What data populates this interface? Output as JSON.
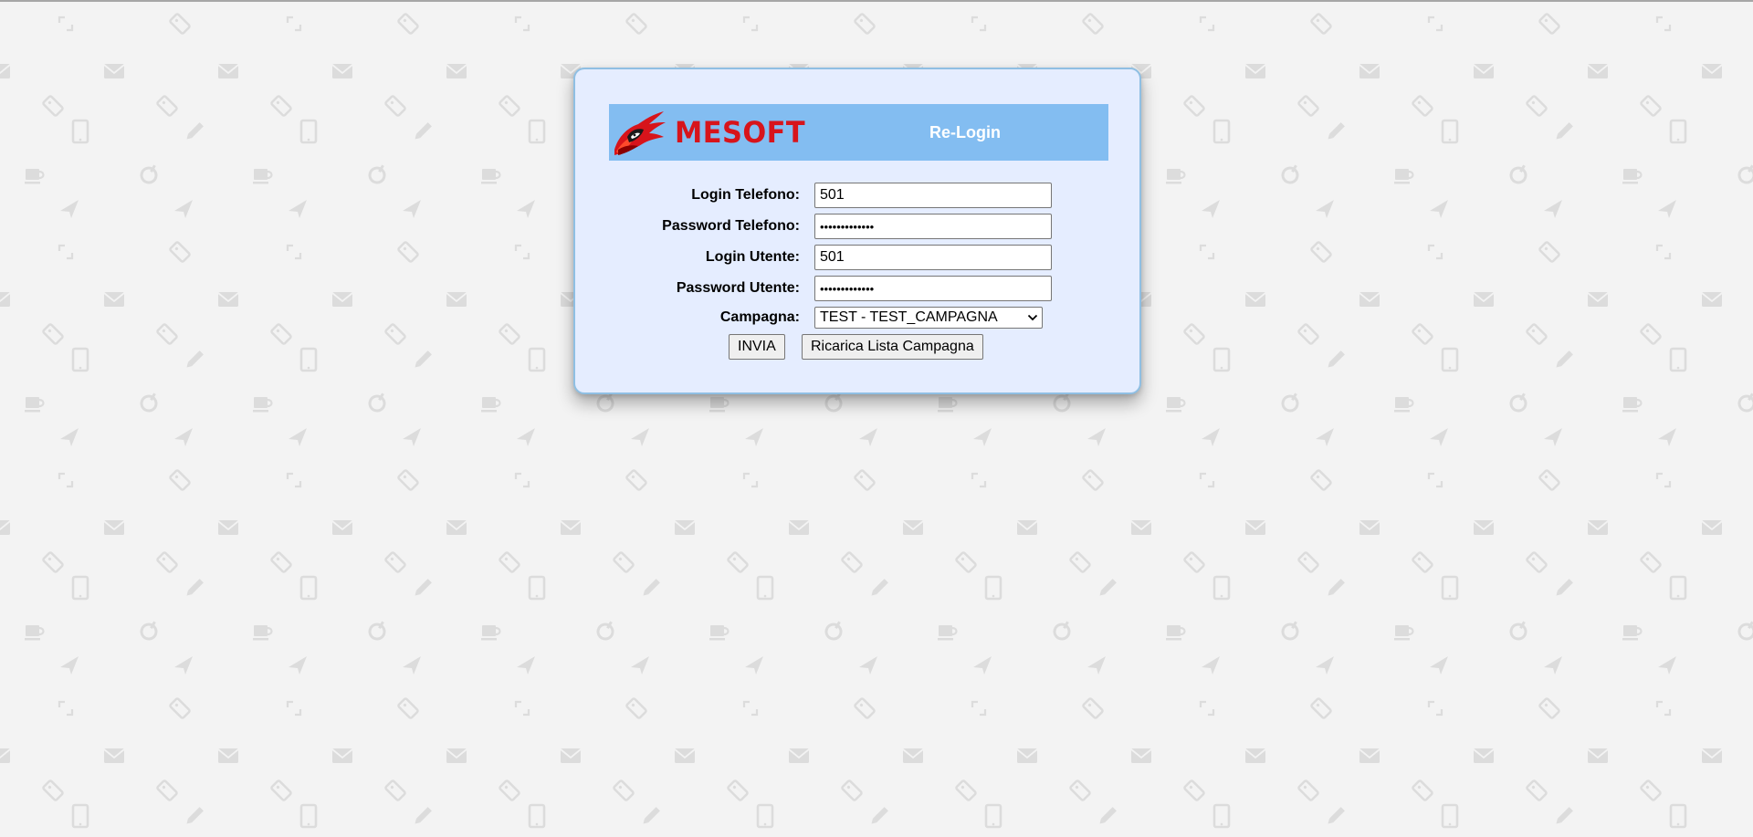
{
  "header": {
    "logo_text": "MESOFT",
    "title": "Re-Login"
  },
  "form": {
    "login_telefono": {
      "label": "Login Telefono:",
      "value": "501"
    },
    "password_telefono": {
      "label": "Password Telefono:",
      "value": "•••••••••••••"
    },
    "login_utente": {
      "label": "Login Utente:",
      "value": "501"
    },
    "password_utente": {
      "label": "Password Utente:",
      "value": "•••••••••••••"
    },
    "campagna": {
      "label": "Campagna:",
      "selected": "TEST - TEST_CAMPAGNA"
    }
  },
  "buttons": {
    "submit_label": "INVIA",
    "reload_label": "Ricarica Lista Campagna"
  },
  "colors": {
    "page_background": "#f3f3f3",
    "panel_background": "#e5edff",
    "panel_border": "#8fbfe3",
    "header_background": "#83bdf1",
    "logo_red": "#d7141b"
  },
  "background_icons": [
    "expand-icon",
    "tag-icon",
    "mail-icon",
    "tablet-icon",
    "pencil-icon",
    "coffee-icon",
    "at-sign-icon",
    "send-icon"
  ]
}
